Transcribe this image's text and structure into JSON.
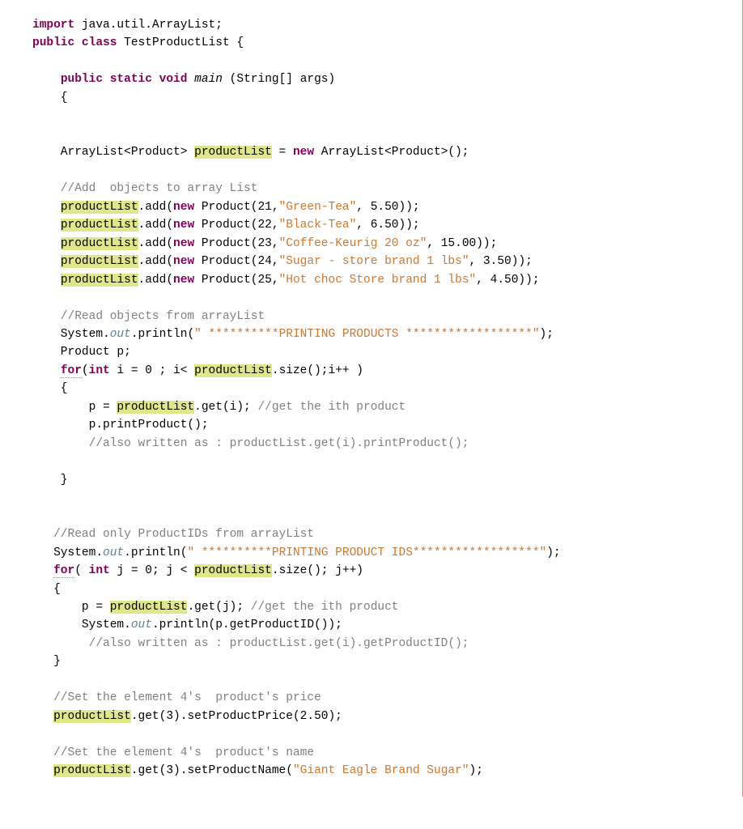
{
  "t": {
    "import": "import",
    "public": "public",
    "class": "class",
    "static": "static",
    "void": "void",
    "new": "new",
    "for": "for",
    "int": "int",
    "javaUtilArrayList": " java.util.ArrayList;",
    "className": " TestProductList {",
    "main": "main",
    "mainArgs": " (String[] args)",
    "openBrace": "    {",
    "arrListDecl1": "    ArrayList<Product> ",
    "productList": "productList",
    "arrListDecl2": " = ",
    "arrListDecl3": " ArrayList<Product>();",
    "cmAdd": "    //Add  objects to array List",
    "add1a": ".add(",
    "add1b": " Product(21,",
    "greenTea": "\"Green-Tea\"",
    "add1c": ", 5.50));",
    "add2b": " Product(22,",
    "blackTea": "\"Black-Tea\"",
    "add2c": ", 6.50));",
    "add3b": " Product(23,",
    "coffee": "\"Coffee-Keurig 20 oz\"",
    "add3c": ", 15.00));",
    "add4b": " Product(24,",
    "sugar": "\"Sugar - store brand 1 lbs\"",
    "add4c": ", 3.50));",
    "add5b": " Product(25,",
    "hotchoc": "\"Hot choc Store brand 1 lbs\"",
    "add5c": ", 4.50));",
    "cmRead": "    //Read objects from arrayList",
    "sysOut1a": "    System.",
    "out": "out",
    "sysOut1b": ".println(",
    "strPrint1": "\" **********PRINTING PRODUCTS ******************\"",
    "sysOut1c": ");",
    "prodP": "    Product p;",
    "for1a": "(",
    "for1b": " i = 0 ; i< ",
    "for1c": ".size();i++ )",
    "brace": "    {",
    "pAssign1": "        p = ",
    "pAssign2": ".get(i); ",
    "cmGetIth": "//get the ith product",
    "pPrint": "        p.printProduct();",
    "cmAlso1": "        //also written as : productList.get(i).printProduct();",
    "closeBrace": "    }",
    "cmReadIDs": "   //Read only ProductIDs from arrayList",
    "sysOut2a": "   System.",
    "strPrint2": "\" **********PRINTING PRODUCT IDS******************\"",
    "for2a": "( ",
    "for2b": " j = 0; j < ",
    "for2c": ".size(); j++)",
    "brace2": "   {",
    "pAssign3": "       p = ",
    "pAssign4": ".get(j); ",
    "sysOut3a": "       System.",
    "sysOut3b": ".println(p.getProductID());",
    "cmAlso2": "        //also written as : productList.get(i).getProductID();",
    "closeBrace2": "   }",
    "cmSetPrice": "   //Set the element 4's  product's price",
    "setPrice": ".get(3).setProductPrice(2.50);",
    "cmSetName": "   //Set the element 4's  product's name",
    "setName1": ".get(3).setProductName(",
    "strGiant": "\"Giant Eagle Brand Sugar\"",
    "setName2": ");",
    "sp1": "    ",
    "sp2": "   "
  }
}
